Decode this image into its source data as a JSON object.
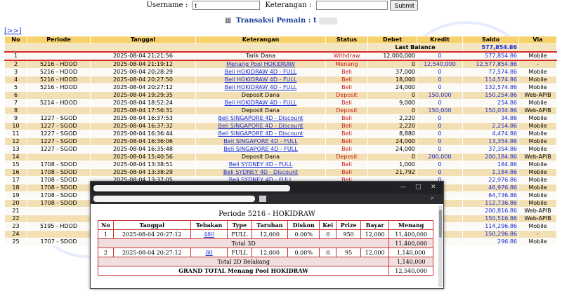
{
  "search_form": {
    "username_label": "Username :",
    "username_value": "t",
    "keterangan_label": "Keterangan :",
    "keterangan_value": "",
    "submit_label": "Submit"
  },
  "page_title": {
    "text": "Transaksi   Pemain : t"
  },
  "nav_link": "[>>]",
  "table": {
    "headers": [
      "No",
      "Periode",
      "Tanggal",
      "Keterangan",
      "Status",
      "Debet",
      "Kredit",
      "Saldo",
      "Via"
    ],
    "last_balance_label": "Last Balance",
    "last_balance_value": "577,854.86",
    "rows": [
      {
        "no": "1",
        "periode": "",
        "tanggal": "2025-08-04 21:21:56",
        "ket": "Tarik Dana",
        "link": false,
        "status": "Withdraw",
        "debet": "12,000,000",
        "kredit": "0",
        "saldo": "577,854.86",
        "via": "Mobile"
      },
      {
        "no": "2",
        "periode": "5216 - HDOD",
        "tanggal": "2025-08-04 21:19:12",
        "ket": "Menang Pool HOKIDRAW",
        "link": true,
        "status": "Menang",
        "debet": "0",
        "kredit": "12,540,000",
        "saldo": "12,577,854.86",
        "via": "-"
      },
      {
        "no": "3",
        "periode": "5216 - HDOD",
        "tanggal": "2025-08-04 20:28:29",
        "ket": "Beli HOKIDRAW 4D - FULL",
        "link": true,
        "status": "Beli",
        "debet": "37,000",
        "kredit": "0",
        "saldo": "77,574.86",
        "via": "Mobile"
      },
      {
        "no": "4",
        "periode": "5216 - HDOD",
        "tanggal": "2025-08-04 20:27:50",
        "ket": "Beli HOKIDRAW 4D - FULL",
        "link": true,
        "status": "Beli",
        "debet": "18,000",
        "kredit": "0",
        "saldo": "114,574.86",
        "via": "Mobile"
      },
      {
        "no": "5",
        "periode": "5216 - HDOD",
        "tanggal": "2025-08-04 20:27:12",
        "ket": "Beli HOKIDRAW 4D - FULL",
        "link": true,
        "status": "Beli",
        "debet": "24,000",
        "kredit": "0",
        "saldo": "132,574.86",
        "via": "Mobile"
      },
      {
        "no": "6",
        "periode": "",
        "tanggal": "2025-08-04 19:29:35",
        "ket": "Deposit Dana",
        "link": false,
        "status": "Deposit",
        "debet": "0",
        "kredit": "150,000",
        "saldo": "150,254.86",
        "via": "Web-APIB"
      },
      {
        "no": "7",
        "periode": "5214 - HDOD",
        "tanggal": "2025-08-04 18:52:24",
        "ket": "Beli HOKIDRAW 4D - FULL",
        "link": true,
        "status": "Beli",
        "debet": "9,000",
        "kredit": "0",
        "saldo": "254.86",
        "via": "Mobile"
      },
      {
        "no": "8",
        "periode": "",
        "tanggal": "2025-08-04 17:56:31",
        "ket": "Deposit Dana",
        "link": false,
        "status": "Deposit",
        "debet": "0",
        "kredit": "150,000",
        "saldo": "150,034.86",
        "via": "Web-APIB"
      },
      {
        "no": "9",
        "periode": "1227 - SGOD",
        "tanggal": "2025-08-04 16:37:53",
        "ket": "Beli SINGAPORE 4D - Discount",
        "link": true,
        "status": "Beli",
        "debet": "2,220",
        "kredit": "0",
        "saldo": "34.86",
        "via": "Mobile"
      },
      {
        "no": "10",
        "periode": "1227 - SGOD",
        "tanggal": "2025-08-04 16:37:32",
        "ket": "Beli SINGAPORE 4D - Discount",
        "link": true,
        "status": "Beli",
        "debet": "2,220",
        "kredit": "0",
        "saldo": "2,254.86",
        "via": "Mobile"
      },
      {
        "no": "11",
        "periode": "1227 - SGOD",
        "tanggal": "2025-08-04 16:36:44",
        "ket": "Beli SINGAPORE 4D - Discount",
        "link": true,
        "status": "Beli",
        "debet": "8,880",
        "kredit": "0",
        "saldo": "4,474.86",
        "via": "Mobile"
      },
      {
        "no": "12",
        "periode": "1227 - SGOD",
        "tanggal": "2025-08-04 16:36:06",
        "ket": "Beli SINGAPORE 4D - FULL",
        "link": true,
        "status": "Beli",
        "debet": "24,000",
        "kredit": "0",
        "saldo": "13,354.86",
        "via": "Mobile"
      },
      {
        "no": "13",
        "periode": "1227 - SGOD",
        "tanggal": "2025-08-04 16:35:48",
        "ket": "Beli SINGAPORE 4D - FULL",
        "link": true,
        "status": "Beli",
        "debet": "24,000",
        "kredit": "0",
        "saldo": "37,354.86",
        "via": "Mobile"
      },
      {
        "no": "14",
        "periode": "",
        "tanggal": "2025-08-04 15:40:56",
        "ket": "Deposit Dana",
        "link": false,
        "status": "Deposit",
        "debet": "0",
        "kredit": "200,000",
        "saldo": "200,184.86",
        "via": "Web-APIB"
      },
      {
        "no": "15",
        "periode": "1708 - SDOD",
        "tanggal": "2025-08-04 13:38:51",
        "ket": "Beli SYDNEY 4D - FULL",
        "link": true,
        "status": "Beli",
        "debet": "1,000",
        "kredit": "0",
        "saldo": "184.86",
        "via": "Mobile"
      },
      {
        "no": "16",
        "periode": "1708 - SDOD",
        "tanggal": "2025-08-04 13:38:29",
        "ket": "Beli SYDNEY 4D - Discount",
        "link": true,
        "status": "Beli",
        "debet": "21,792",
        "kredit": "0",
        "saldo": "1,184.86",
        "via": "Mobile"
      },
      {
        "no": "17",
        "periode": "1708 - SDOD",
        "tanggal": "2025-08-04 13:37:05",
        "ket": "Beli SYDNEY 4D - FULL",
        "link": true,
        "status": "Beli",
        "debet": "",
        "kredit": "0",
        "saldo": "22,976.86",
        "via": "Mobile"
      },
      {
        "no": "18",
        "periode": "1708 - SDOD",
        "tanggal": "",
        "ket": "",
        "link": false,
        "status": "",
        "debet": "",
        "kredit": "0",
        "saldo": "46,976.86",
        "via": "Mobile"
      },
      {
        "no": "19",
        "periode": "1708 - SDOD",
        "tanggal": "",
        "ket": "",
        "link": false,
        "status": "",
        "debet": "",
        "kredit": "0",
        "saldo": "64,736.86",
        "via": "Mobile"
      },
      {
        "no": "20",
        "periode": "1708 - SDOD",
        "tanggal": "",
        "ket": "",
        "link": false,
        "status": "",
        "debet": "",
        "kredit": "0",
        "saldo": "112,736.86",
        "via": "Mobile"
      },
      {
        "no": "21",
        "periode": "",
        "tanggal": "",
        "ket": "",
        "link": false,
        "status": "",
        "debet": "",
        "kredit": "0",
        "saldo": "200,816.86",
        "via": "Web-APIB"
      },
      {
        "no": "22",
        "periode": "",
        "tanggal": "",
        "ket": "",
        "link": false,
        "status": "",
        "debet": "",
        "kredit": "0",
        "saldo": "150,516.86",
        "via": "Web-APIB"
      },
      {
        "no": "23",
        "periode": "5195 - HDOD",
        "tanggal": "",
        "ket": "",
        "link": false,
        "status": "",
        "debet": "",
        "kredit": "0",
        "saldo": "114,296.86",
        "via": "Mobile"
      },
      {
        "no": "24",
        "periode": "",
        "tanggal": "",
        "ket": "",
        "link": false,
        "status": "",
        "debet": "",
        "kredit": "0",
        "saldo": "150,296.86",
        "via": "-"
      },
      {
        "no": "25",
        "periode": "1707 - SDOD",
        "tanggal": "",
        "ket": "",
        "link": false,
        "status": "",
        "debet": "",
        "kredit": "0",
        "saldo": "296.86",
        "via": "Mobile"
      }
    ]
  },
  "popup": {
    "window_controls": {
      "minimize": "—",
      "maximize": "□",
      "close": "✕",
      "zoom": "⌕"
    },
    "heading": "Periode 5216 - HOKIDRAW",
    "headers": [
      "No",
      "Tanggal",
      "Tebakan",
      "Type",
      "Taruhan",
      "Diskon",
      "Kei",
      "Prize",
      "Bayar",
      "Menang"
    ],
    "rows": [
      {
        "no": "1",
        "tanggal": "2025-08-04 20:27:12",
        "tebakan": "480",
        "type": "FULL",
        "taruhan": "12,000",
        "diskon": "0.00%",
        "kei": "0",
        "prize": "950",
        "bayar": "12,000",
        "menang": "11,400,000"
      },
      {
        "total_label": "Total 3D",
        "total_value": "11,400,000"
      },
      {
        "no": "2",
        "tanggal": "2025-08-04 20:27:12",
        "tebakan": "80",
        "type": "FULL",
        "taruhan": "12,000",
        "diskon": "0.00%",
        "kei": "0",
        "prize": "95",
        "bayar": "12,000",
        "menang": "1,140,000"
      },
      {
        "total_label": "Total 2D Belakang",
        "total_value": "1,140,000"
      }
    ],
    "grand_total_label": "GRAND TOTAL  Menang Pool HOKIDRAW",
    "grand_total_value": "12,540,000"
  },
  "colors": {
    "header_bg": "#f6d16c",
    "link": "#1a2fd8",
    "status_red": "#c62020",
    "selection_border": "#d42b2b"
  }
}
